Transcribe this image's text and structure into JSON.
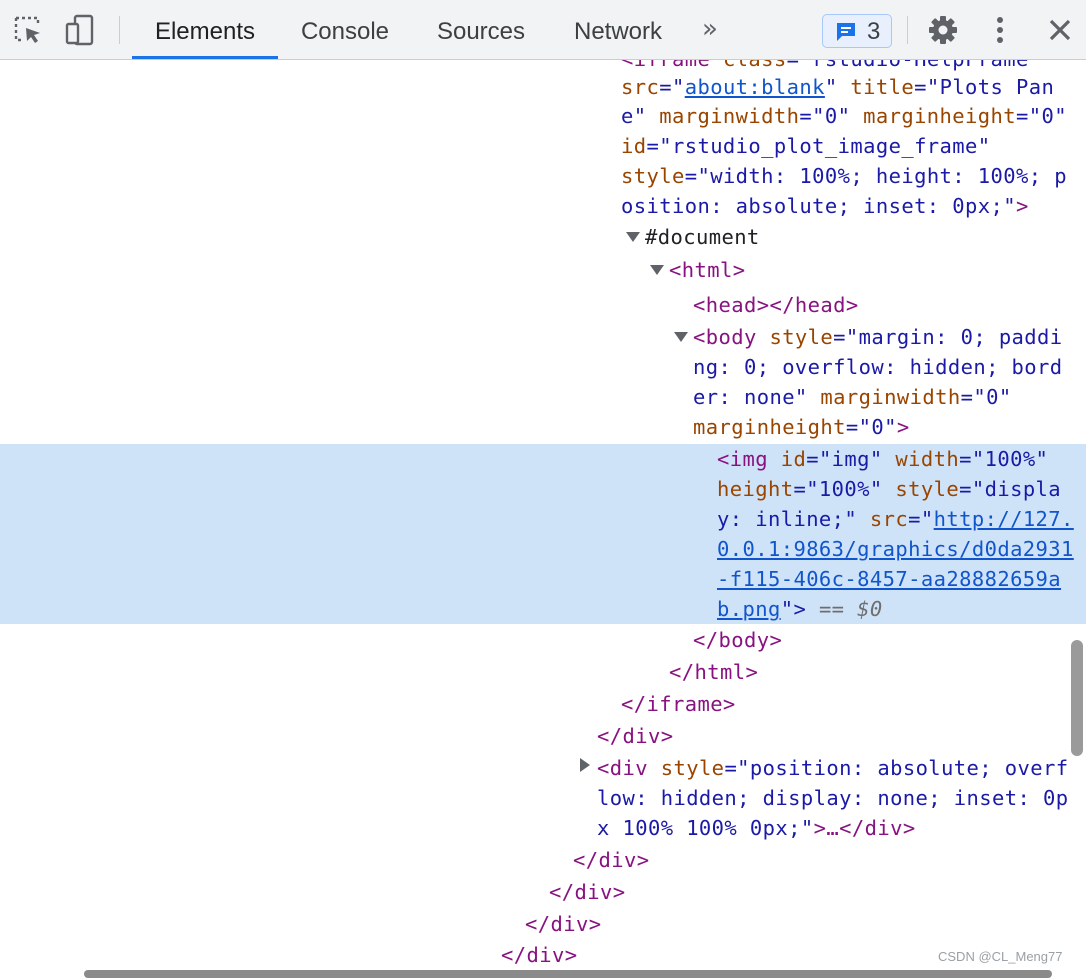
{
  "toolbar": {
    "tabs": [
      {
        "label": "Elements",
        "active": true
      },
      {
        "label": "Console",
        "active": false
      },
      {
        "label": "Sources",
        "active": false
      },
      {
        "label": "Network",
        "active": false
      }
    ],
    "more_tabs_glyph": "»",
    "issues_count": "3",
    "icons": [
      "inspect-element-icon",
      "device-toolbar-icon",
      "message-icon",
      "settings-gear-icon",
      "more-vert-icon",
      "close-icon"
    ]
  },
  "code": {
    "l0": {
      "a": "<iframe ",
      "b": "class",
      "c": "=\"rstudio-HelpFrame"
    },
    "l1": {
      "a": "src",
      "b": "=\"",
      "c": "about:blank",
      "d": "\"",
      "e": " title",
      "f": "=\"Plots Pan"
    },
    "l2": {
      "a": "e\"",
      "b": " marginwidth",
      "c": "=\"0\"",
      "d": " marginheight",
      "e": "=\"0\""
    },
    "l3": {
      "a": "id",
      "b": "=\"rstudio_plot_image_frame\""
    },
    "l4": {
      "a": "style",
      "b": "=\"width: 100%; height: 100%; p"
    },
    "l5": {
      "a": "osition: absolute; inset: 0px;\"",
      "b": ">"
    },
    "l6": {
      "a": "#document"
    },
    "l7": {
      "a": "<html>"
    },
    "l8": {
      "a": "<head></head>"
    },
    "l9": {
      "a": "<body ",
      "b": "style",
      "c": "=\"margin: 0; paddi"
    },
    "l10": {
      "a": "ng: 0; overflow: hidden; bord"
    },
    "l11": {
      "a": "er: none\"",
      "b": " marginwidth",
      "c": "=\"0\""
    },
    "l12": {
      "a": "marginheight",
      "b": "=\"0\"",
      "c": ">"
    },
    "l13": {
      "a": "<img ",
      "b": "id",
      "c": "=\"img\"",
      "d": " width",
      "e": "=\"100%\""
    },
    "l14": {
      "a": "height",
      "b": "=\"100%\"",
      "c": " style",
      "d": "=\"displa"
    },
    "l15": {
      "a": "y: inline;\"",
      "b": " src",
      "c": "=\"",
      "d": "http://127."
    },
    "l16": {
      "a": "0.0.1:9863/graphics/d0da2931"
    },
    "l17": {
      "a": "-f115-406c-8457-aa28882659a"
    },
    "l18": {
      "a": "b.png",
      "b": "\">",
      "c": " == ",
      "d": "$0"
    },
    "l19": {
      "a": "</body>"
    },
    "l20": {
      "a": "</html>"
    },
    "l21": {
      "a": "</iframe>"
    },
    "l22": {
      "a": "</div>"
    },
    "l23": {
      "a": "<div ",
      "b": "style",
      "c": "=\"position: absolute; overf"
    },
    "l24": {
      "a": "low: hidden; display: none; inset: 0p"
    },
    "l25": {
      "a": "x 100% 100% 0px;\"",
      "b": ">…</div>"
    },
    "l26": {
      "a": "</div>"
    },
    "l27": {
      "a": "</div>"
    },
    "l28": {
      "a": "</div>"
    },
    "l29": {
      "a": "</div>"
    }
  },
  "watermark": "CSDN @CL_Meng77",
  "colors": {
    "accent": "#1a73e8",
    "highlight": "#cfe3f8",
    "tag": "#881280",
    "attr": "#994500",
    "value": "#1a1aa6"
  }
}
